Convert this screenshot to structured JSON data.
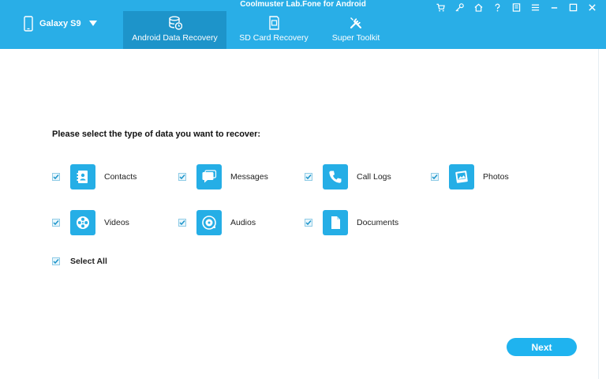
{
  "app": {
    "title": "Coolmuster Lab.Fone for Android"
  },
  "device": {
    "name": "Galaxy S9"
  },
  "tabs": [
    {
      "label": "Android Data Recovery",
      "active": true,
      "icon": "database-clock-icon"
    },
    {
      "label": "SD Card Recovery",
      "active": false,
      "icon": "sd-card-icon"
    },
    {
      "label": "Super Toolkit",
      "active": false,
      "icon": "tools-icon"
    }
  ],
  "window_controls": [
    "cart-icon",
    "key-icon",
    "home-icon",
    "help-icon",
    "feedback-icon",
    "menu-icon",
    "minimize-icon",
    "restore-icon",
    "close-icon"
  ],
  "main": {
    "prompt": "Please select the type of data you want to recover:",
    "items": [
      {
        "label": "Contacts",
        "checked": true,
        "icon": "contacts-icon"
      },
      {
        "label": "Messages",
        "checked": true,
        "icon": "messages-icon"
      },
      {
        "label": "Call Logs",
        "checked": true,
        "icon": "call-logs-icon"
      },
      {
        "label": "Photos",
        "checked": true,
        "icon": "photos-icon"
      },
      {
        "label": "Videos",
        "checked": true,
        "icon": "videos-icon"
      },
      {
        "label": "Audios",
        "checked": true,
        "icon": "audios-icon"
      },
      {
        "label": "Documents",
        "checked": true,
        "icon": "documents-icon"
      }
    ],
    "select_all": {
      "label": "Select All",
      "checked": true
    }
  },
  "footer": {
    "next_label": "Next"
  },
  "colors": {
    "titlebar": "#29aee7",
    "active_tab": "#1d94ca",
    "tile": "#25aee6",
    "button": "#1fb3ef"
  }
}
